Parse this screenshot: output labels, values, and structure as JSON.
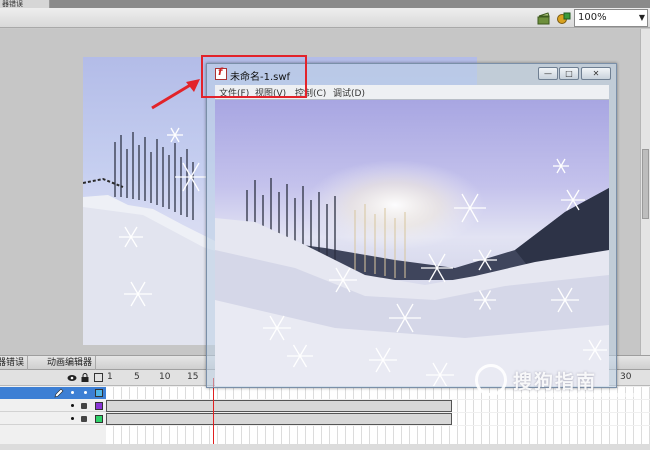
{
  "top_tab": {
    "label": "器错误"
  },
  "toolbar": {
    "zoom": "100%"
  },
  "panel_tabs": {
    "compiler_errors": "器错误",
    "motion_editor": "动画编辑器"
  },
  "timeline": {
    "frame_numbers": [
      "1",
      "5",
      "10",
      "15",
      "30"
    ],
    "layer_colors": [
      "#4fb4e6",
      "#8a35d6",
      "#2fd26a"
    ]
  },
  "swf_window": {
    "title": "未命名-1.swf",
    "menu": [
      "文件(F)",
      "视图(V)",
      "控制(C)",
      "调试(D)"
    ],
    "controls": {
      "minimize": "—",
      "maximize": "□",
      "close": "✕"
    }
  },
  "watermark": {
    "text": "搜狗指南"
  },
  "colors": {
    "highlight": "#e2232a",
    "playhead": "#e02020"
  }
}
